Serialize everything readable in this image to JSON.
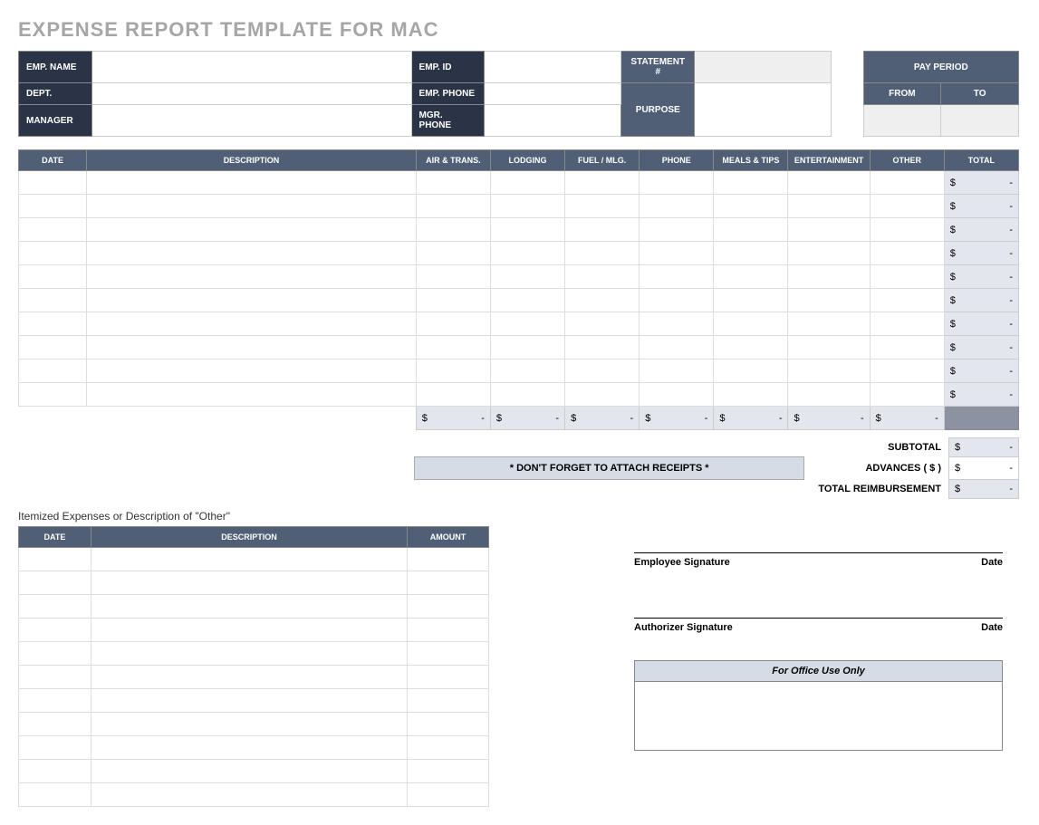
{
  "title": "EXPENSE REPORT TEMPLATE FOR MAC",
  "header_labels": {
    "emp_name": "EMP. NAME",
    "emp_id": "EMP. ID",
    "statement": "STATEMENT #",
    "pay_period": "PAY PERIOD",
    "dept": "DEPT.",
    "emp_phone": "EMP. PHONE",
    "purpose": "PURPOSE",
    "from": "FROM",
    "to": "TO",
    "manager": "MANAGER",
    "mgr_phone": "MGR. PHONE"
  },
  "main_columns": [
    "DATE",
    "DESCRIPTION",
    "AIR & TRANS.",
    "LODGING",
    "FUEL / MLG.",
    "PHONE",
    "MEALS & TIPS",
    "ENTERTAINMENT",
    "OTHER",
    "TOTAL"
  ],
  "main_rows": 10,
  "currency": "$",
  "dash": "-",
  "receipts_note": "* DON'T FORGET TO ATTACH RECEIPTS *",
  "summary": {
    "subtotal": "SUBTOTAL",
    "advances": "ADVANCES  ( $ )",
    "total_reimb": "TOTAL REIMBURSEMENT"
  },
  "itemized_title": "Itemized Expenses or Description of \"Other\"",
  "itemized_columns": [
    "DATE",
    "DESCRIPTION",
    "AMOUNT"
  ],
  "itemized_rows": 11,
  "signatures": {
    "employee": "Employee Signature",
    "authorizer": "Authorizer Signature",
    "date": "Date"
  },
  "office_use": "For Office Use Only"
}
